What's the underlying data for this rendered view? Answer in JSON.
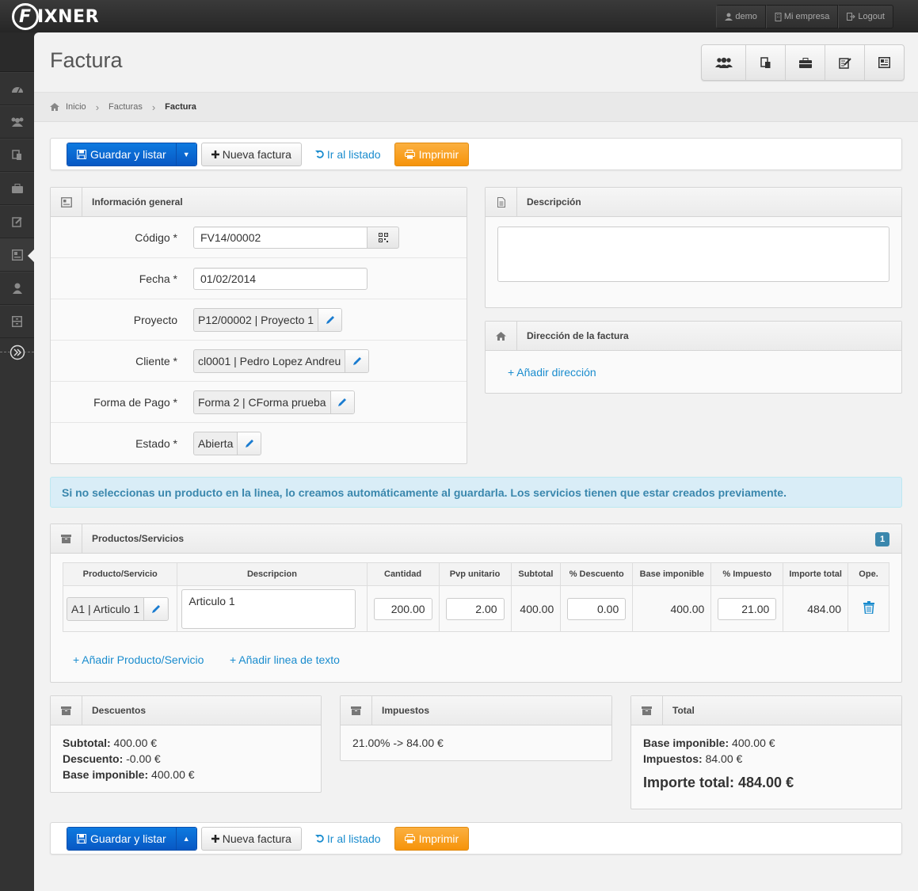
{
  "app": {
    "logo_mark": "F",
    "logo_text": "IXNER"
  },
  "topbar": {
    "demo": "demo",
    "empresa": "Mi empresa",
    "logout": "Logout"
  },
  "page": {
    "title": "Factura"
  },
  "breadcrumb": {
    "home": "Inicio",
    "list": "Facturas",
    "current": "Factura"
  },
  "toolbar": {
    "save": "Guardar y listar",
    "new": "Nueva factura",
    "list": "Ir al listado",
    "print": "Imprimir"
  },
  "general": {
    "title": "Información general",
    "codigo_label": "Código *",
    "codigo_value": "FV14/00002",
    "fecha_label": "Fecha *",
    "fecha_value": "01/02/2014",
    "proyecto_label": "Proyecto",
    "proyecto_value": "P12/00002 | Proyecto 1",
    "cliente_label": "Cliente *",
    "cliente_value": "cl0001 | Pedro Lopez Andreu",
    "pago_label": "Forma de Pago *",
    "pago_value": "Forma 2 | CForma prueba",
    "estado_label": "Estado *",
    "estado_value": "Abierta"
  },
  "descripcion": {
    "title": "Descripción",
    "value": ""
  },
  "direccion": {
    "title": "Dirección de la factura",
    "add": "+ Añadir dirección"
  },
  "alert": {
    "text": "Si no seleccionas un producto en la linea, lo creamos automáticamente al guardarla. Los servicios tienen que estar creados previamente."
  },
  "productos": {
    "title": "Productos/Servicios",
    "count": "1",
    "headers": [
      "Producto/Servicio",
      "Descripcion",
      "Cantidad",
      "Pvp unitario",
      "Subtotal",
      "% Descuento",
      "Base imponible",
      "% Impuesto",
      "Importe total",
      "Ope."
    ],
    "row": {
      "producto": "A1 | Articulo 1",
      "descripcion": "Articulo 1",
      "cantidad": "200.00",
      "pvp": "2.00",
      "subtotal": "400.00",
      "descuento": "0.00",
      "base": "400.00",
      "impuesto": "21.00",
      "total": "484.00"
    },
    "add_product": "+ Añadir Producto/Servicio",
    "add_text": "+ Añadir linea de texto"
  },
  "descuentos": {
    "title": "Descuentos",
    "subtotal_label": "Subtotal:",
    "subtotal": "400.00 €",
    "descuento_label": "Descuento:",
    "descuento": "-0.00 €",
    "base_label": "Base imponible:",
    "base": "400.00 €"
  },
  "impuestos": {
    "title": "Impuestos",
    "line": "21.00% -> 84.00 €"
  },
  "total": {
    "title": "Total",
    "base_label": "Base imponible:",
    "base": "400.00 €",
    "impuestos_label": "Impuestos:",
    "impuestos": "84.00 €",
    "importe_label": "Importe total:",
    "importe": "484.00 €"
  },
  "icons": [
    "dashboard-icon",
    "users-icon",
    "documents-icon",
    "briefcase-icon",
    "edit-icon",
    "invoice-icon",
    "user-icon",
    "archive-icon",
    "expand-icon"
  ],
  "colors": {
    "primary": "#0a6fd6",
    "warning": "#f6a01e",
    "link": "#1a8cce",
    "info_bg": "#d9edf7",
    "info_text": "#3a87ad"
  }
}
